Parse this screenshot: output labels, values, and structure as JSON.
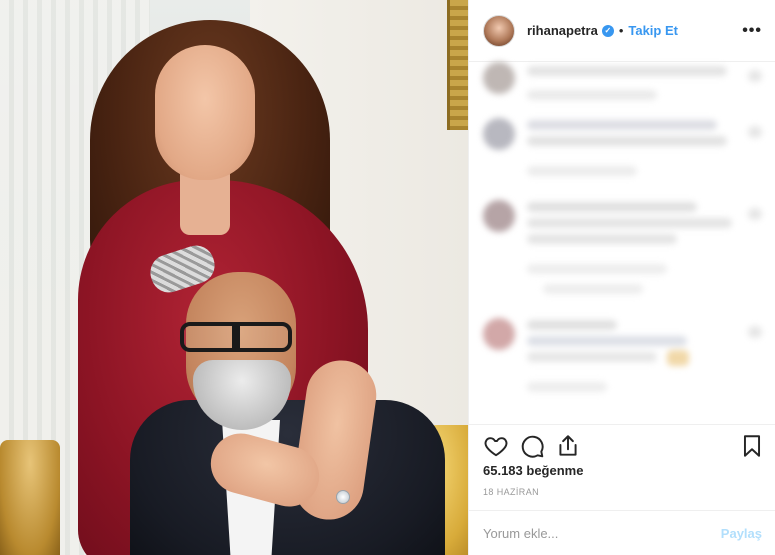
{
  "post": {
    "username": "rihanapetra",
    "verified_icon": "verified-badge-icon",
    "separator": "•",
    "follow_label": "Takip Et",
    "more_label": "•••",
    "likes": "65.183 beğenme",
    "date": "18 HAZİRAN",
    "comment_placeholder": "Yorum ekle...",
    "comment_post_label": "Paylaş"
  },
  "colors": {
    "accent": "#3897f0",
    "post_disabled": "#b2dffc",
    "muted": "#999999",
    "text": "#262626"
  },
  "icons": {
    "like": "heart-icon",
    "comment": "comment-bubble-icon",
    "share": "share-icon",
    "save": "bookmark-icon"
  }
}
